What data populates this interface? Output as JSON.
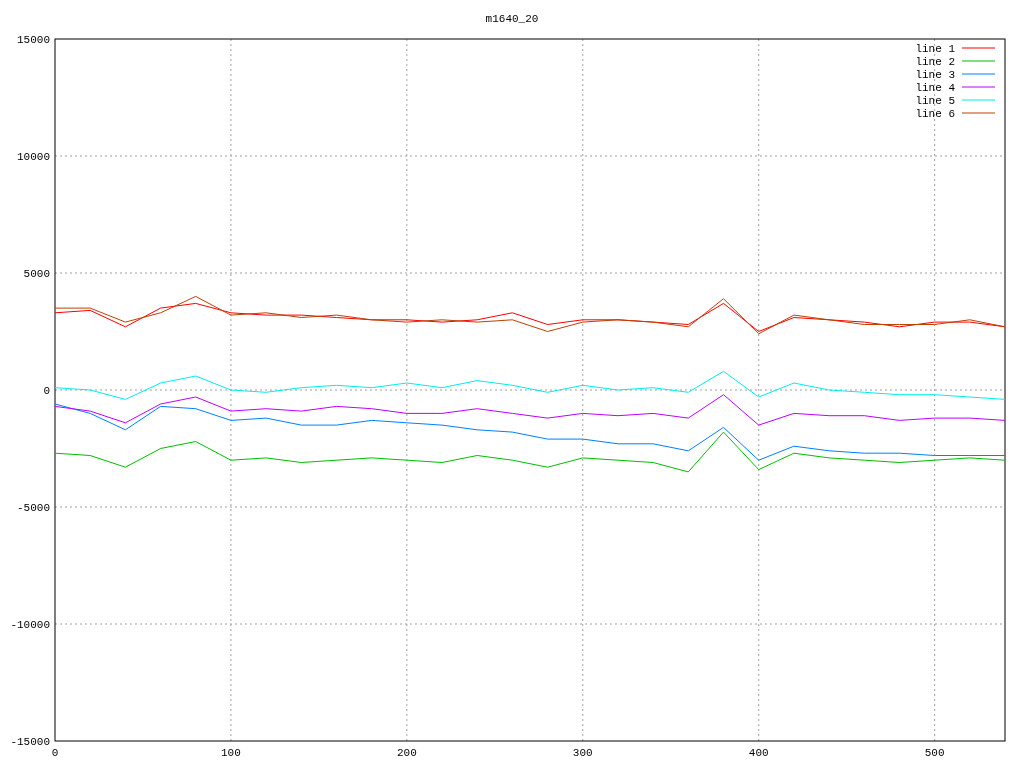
{
  "chart": {
    "chart_data": {
      "type": "line",
      "title": "m1640_20",
      "x": [
        0,
        20,
        40,
        60,
        80,
        100,
        120,
        140,
        160,
        180,
        200,
        220,
        240,
        260,
        280,
        300,
        320,
        340,
        360,
        380,
        400,
        420,
        440,
        460,
        480,
        500,
        520,
        540
      ],
      "series": [
        {
          "name": "line 1",
          "color": "#ff0000",
          "values": [
            3300,
            3400,
            2700,
            3500,
            3700,
            3300,
            3200,
            3200,
            3100,
            3000,
            3000,
            2900,
            3000,
            3300,
            2800,
            3000,
            3000,
            2900,
            2800,
            3700,
            2500,
            3100,
            3000,
            2900,
            2700,
            2900,
            2900,
            2700
          ]
        },
        {
          "name": "line 2",
          "color": "#00c000",
          "values": [
            -2700,
            -2800,
            -3300,
            -2500,
            -2200,
            -3000,
            -2900,
            -3100,
            -3000,
            -2900,
            -3000,
            -3100,
            -2800,
            -3000,
            -3300,
            -2900,
            -3000,
            -3100,
            -3500,
            -1800,
            -3400,
            -2700,
            -2900,
            -3000,
            -3100,
            -3000,
            -2900,
            -3000
          ]
        },
        {
          "name": "line 3",
          "color": "#0080ff",
          "values": [
            -600,
            -1000,
            -1700,
            -700,
            -800,
            -1300,
            -1200,
            -1500,
            -1500,
            -1300,
            -1400,
            -1500,
            -1700,
            -1800,
            -2100,
            -2100,
            -2300,
            -2300,
            -2600,
            -1600,
            -3000,
            -2400,
            -2600,
            -2700,
            -2700,
            -2800,
            -2800,
            -2800
          ]
        },
        {
          "name": "line 4",
          "color": "#c000ff",
          "values": [
            -700,
            -900,
            -1400,
            -600,
            -300,
            -900,
            -800,
            -900,
            -700,
            -800,
            -1000,
            -1000,
            -800,
            -1000,
            -1200,
            -1000,
            -1100,
            -1000,
            -1200,
            -200,
            -1500,
            -1000,
            -1100,
            -1100,
            -1300,
            -1200,
            -1200,
            -1300
          ]
        },
        {
          "name": "line 5",
          "color": "#00eeee",
          "values": [
            100,
            0,
            -400,
            300,
            600,
            0,
            -100,
            100,
            200,
            100,
            300,
            100,
            400,
            200,
            -100,
            200,
            0,
            100,
            -100,
            800,
            -300,
            300,
            0,
            -100,
            -200,
            -200,
            -300,
            -400
          ]
        },
        {
          "name": "line 6",
          "color": "#c04000",
          "values": [
            3500,
            3500,
            2900,
            3300,
            4000,
            3200,
            3300,
            3100,
            3200,
            3000,
            2900,
            3000,
            2900,
            3000,
            2500,
            2900,
            3000,
            2900,
            2700,
            3900,
            2400,
            3200,
            3000,
            2800,
            2800,
            2800,
            3000,
            2700
          ]
        }
      ],
      "xlim": [
        0,
        540
      ],
      "ylim": [
        -15000,
        15000
      ],
      "xticks": [
        0,
        100,
        200,
        300,
        400,
        500
      ],
      "yticks": [
        -15000,
        -10000,
        -5000,
        0,
        5000,
        10000,
        15000
      ],
      "grid": true,
      "legend": true
    }
  }
}
